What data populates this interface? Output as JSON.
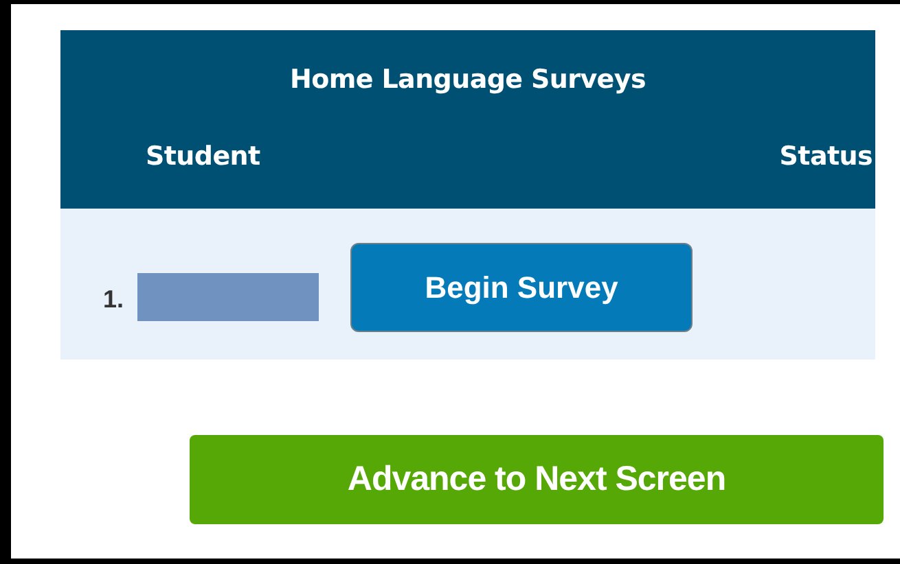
{
  "table": {
    "title": "Home Language Surveys",
    "columns": [
      "Student",
      "Status"
    ],
    "rows": [
      {
        "number": "1.",
        "action": "Begin Survey"
      }
    ]
  },
  "advance_button": "Advance to Next Screen"
}
